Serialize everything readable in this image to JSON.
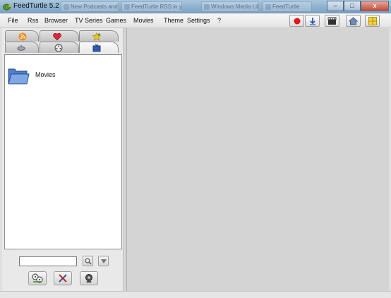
{
  "window": {
    "title": "FeedTurtle 5.2",
    "taskbar_items": [
      "New Podcasts and...",
      "FeedTurtle RSS in yo...",
      "Windows Media Lib...",
      "FeedTurtle"
    ],
    "minimize_label": "–",
    "maximize_label": "□",
    "close_label": "x"
  },
  "menu": {
    "items": [
      "File",
      "Rss",
      "Browser",
      "TV Series",
      "Games",
      "Movies",
      "Theme",
      "Settings",
      "?"
    ]
  },
  "toolbar": {
    "icons": [
      "record-icon",
      "download-icon",
      "clapperboard-icon",
      "home-icon",
      "grid-icon"
    ],
    "accent_red": "#e01818"
  },
  "left_panel": {
    "tabs_top": [
      "rss-feed-icon",
      "heart-icon",
      "star-icon"
    ],
    "tabs_bottom": [
      "satellite-icon",
      "film-reel-icon",
      "tv-icon"
    ],
    "tree": [
      {
        "label": "Movies",
        "icon": "folder-icon"
      }
    ],
    "search": {
      "value": "",
      "placeholder": ""
    },
    "bottom_buttons": [
      "film-reels-button",
      "tools-button",
      "webcam-button"
    ]
  }
}
